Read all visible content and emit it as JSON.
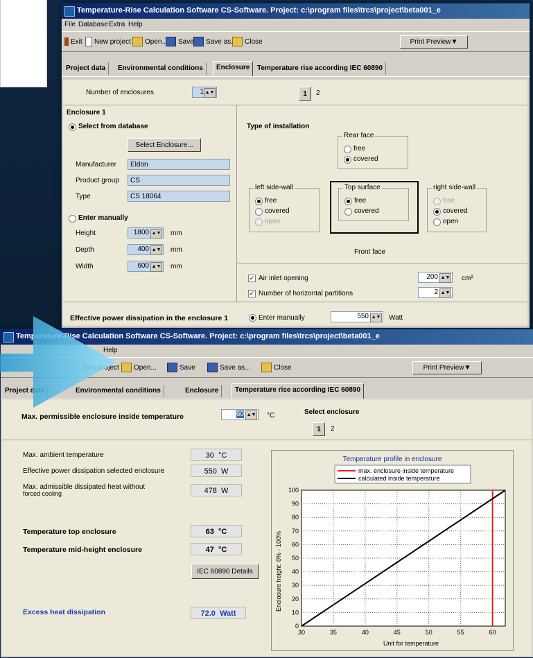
{
  "top_window": {
    "title": "Temperature-Rise Calculation Software CS-Software. Project: c:\\program files\\trcs\\project\\beta001_e",
    "menu": [
      "File",
      "Database",
      "Extra",
      "Help"
    ],
    "toolbar": {
      "exit": "Exit",
      "new_project": "New project",
      "open": "Open...",
      "save": "Save",
      "save_as": "Save as...",
      "close": "Close",
      "print_preview": "Print Preview▼"
    },
    "tabs": [
      "Project data",
      "Environmental conditions",
      "Enclosure",
      "Temperature rise according IEC 60890"
    ],
    "active_tab": "Enclosure",
    "number_of_enclosures_label": "Number of enclosures",
    "number_of_enclosures_value": "1",
    "enclosure_selector": [
      "1",
      "2"
    ],
    "enclosure_title": "Enclosure 1",
    "select_from_db_label": "Select from database",
    "select_enclosure_button": "Select Enclosure...",
    "manufacturer_label": "Manufacturer",
    "manufacturer_value": "Eldon",
    "product_group_label": "Product group",
    "product_group_value": "CS",
    "type_label": "Type",
    "type_value": "CS 18064",
    "enter_manually_label": "Enter manually",
    "height_label": "Height",
    "height_value": "1800",
    "depth_label": "Depth",
    "depth_value": "400",
    "width_label": "Width",
    "width_value": "600",
    "unit_mm": "mm",
    "type_of_installation": "Type of installation",
    "rear_face": {
      "title": "Rear face",
      "options": [
        "free",
        "covered"
      ]
    },
    "left_side": {
      "title": "left side-wall",
      "options": [
        "free",
        "covered",
        "open"
      ]
    },
    "top_surface": {
      "title": "Top surface",
      "options": [
        "free",
        "covered"
      ]
    },
    "right_side": {
      "title": "right side-wall",
      "options": [
        "free",
        "covered",
        "open"
      ]
    },
    "front_face": "Front face",
    "air_inlet_label": "Air inlet opening",
    "air_inlet_value": "200",
    "air_inlet_unit": "cm²",
    "partitions_label": "Number of horizontal partitions",
    "partitions_value": "2",
    "effective_power_label": "Effective power dissipation in the enclosure 1",
    "enter_manually_short": "Enter manually",
    "power_value": "550",
    "power_unit": "Watt"
  },
  "bottom_window": {
    "title": "Temperature-Rise Calculation Software CS-Software. Project: c:\\program files\\trcs\\project\\beta001_e",
    "menu": [
      "Help"
    ],
    "toolbar": {
      "new_project": "New project",
      "open": "Open...",
      "save": "Save",
      "save_as": "Save as...",
      "close": "Close",
      "print_preview": "Print Preview▼"
    },
    "tabs": [
      "Project data",
      "Environmental conditions",
      "Enclosure",
      "Temperature rise according IEC 60890"
    ],
    "active_tab": "Temperature rise according IEC 60890",
    "max_temp_label": "Max. permissible enclosure inside temperature",
    "max_temp_value": "60",
    "max_temp_unit": "°C",
    "select_enclosure_label": "Select enclosure",
    "enclosure_selector": [
      "1",
      "2"
    ],
    "rows": [
      {
        "label": "Max. ambient temperature",
        "value": "30",
        "unit": "°C"
      },
      {
        "label": "Effective power dissipation selected enclosure",
        "value": "550",
        "unit": "W"
      },
      {
        "label": "Max. admissible dissipated heat without",
        "label2": "forced cooling",
        "value": "478",
        "unit": "W"
      }
    ],
    "temp_top_label": "Temperature top enclosure",
    "temp_top_value": "63",
    "temp_mid_label": "Temperature mid-height enclosure",
    "temp_mid_value": "47",
    "temp_unit": "°C",
    "iec_button": "IEC 60890 Details",
    "excess_label": "Excess heat dissipation",
    "excess_value": "72.0",
    "excess_unit": "Watt"
  },
  "chart_data": {
    "type": "line",
    "title": "Temperature profile in enclosure",
    "xlabel": "Unit for temperature",
    "ylabel": "Enclosure height: 0% - 100%",
    "xlim": [
      30,
      62
    ],
    "ylim": [
      0,
      100
    ],
    "xticks": [
      30,
      35,
      40,
      45,
      50,
      55,
      60
    ],
    "yticks": [
      0,
      10,
      20,
      30,
      40,
      50,
      60,
      70,
      80,
      90,
      100
    ],
    "grid": true,
    "legend_position": "top-right",
    "series": [
      {
        "name": "max. enclosure inside temperature",
        "color": "#e02020",
        "x": [
          60,
          60
        ],
        "y": [
          0,
          100
        ]
      },
      {
        "name": "calculated inside temperature",
        "color": "#000000",
        "x": [
          30,
          62
        ],
        "y": [
          0,
          100
        ]
      }
    ]
  },
  "colors": {
    "title_start": "#0a246a",
    "title_end": "#3a6ea5",
    "excess": "#1a3fb0",
    "arrow": "#5bc6ea"
  }
}
